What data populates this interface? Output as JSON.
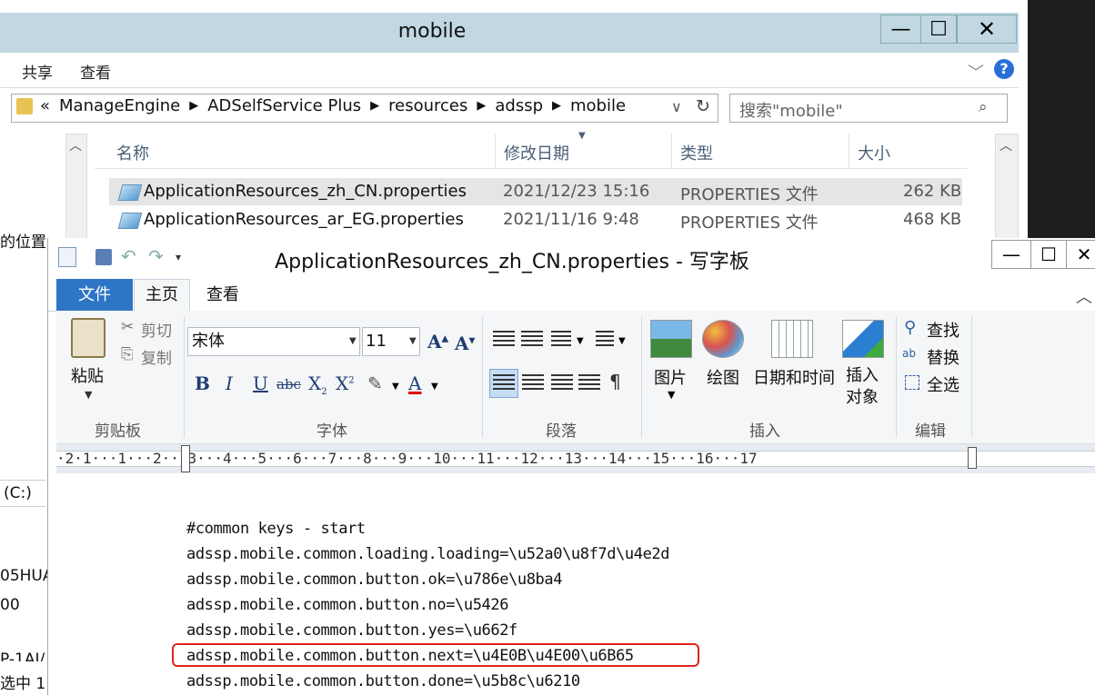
{
  "explorer": {
    "title": "mobile",
    "window_buttons": {
      "minimize": "—",
      "maximize": "☐",
      "close": "✕"
    },
    "ribbon_tabs": [
      "共享",
      "查看"
    ],
    "address_path": [
      "ManageEngine",
      "ADSelfService Plus",
      "resources",
      "adssp",
      "mobile"
    ],
    "address_prefix": "«",
    "search_placeholder": "搜索\"mobile\"",
    "columns": [
      "名称",
      "修改日期",
      "类型",
      "大小"
    ],
    "files": [
      {
        "name": "ApplicationResources_zh_CN.properties",
        "modified": "2021/12/23 15:16",
        "type": "PROPERTIES 文件",
        "size": "262 KB"
      },
      {
        "name": "ApplicationResources_ar_EG.properties",
        "modified": "2021/11/16 9:48",
        "type": "PROPERTIES 文件",
        "size": "468 KB"
      }
    ],
    "nav_fragments": {
      "location": "的位置",
      "drive": "(C:)",
      "frag1": "05HUA",
      "frag2": "00",
      "frag3": "P-1AI/",
      "status": "选中 1"
    }
  },
  "wordpad": {
    "title": "ApplicationResources_zh_CN.properties - 写字板",
    "tabs": {
      "file": "文件",
      "home": "主页",
      "view": "查看"
    },
    "clipboard": {
      "paste": "粘贴",
      "cut": "剪切",
      "copy": "复制",
      "group": "剪贴板"
    },
    "font": {
      "name": "宋体",
      "size": "11",
      "group": "字体"
    },
    "paragraph": {
      "group": "段落"
    },
    "insert": {
      "picture": "图片",
      "paint": "绘图",
      "datetime": "日期和时间",
      "object": "插入对象",
      "group": "插入"
    },
    "editing": {
      "find": "查找",
      "replace": "替换",
      "select_all": "全选",
      "group": "编辑"
    },
    "ruler": "·2·1···1···2···3···4···5···6···7···8···9···10···11···12···13···14···15···16···17",
    "document_lines": [
      "#common keys - start",
      "adssp.mobile.common.loading.loading=\\u52a0\\u8f7d\\u4e2d",
      "adssp.mobile.common.button.ok=\\u786e\\u8ba4",
      "adssp.mobile.common.button.no=\\u5426",
      "adssp.mobile.common.button.yes=\\u662f",
      "adssp.mobile.common.button.next=\\u4E0B\\u4E00\\u6B65",
      "adssp.mobile.common.button.done=\\u5b8c\\u6210"
    ],
    "highlighted_line_index": 5,
    "highlight_color": "#e0241b",
    "accent_color": "#2f75c5"
  }
}
